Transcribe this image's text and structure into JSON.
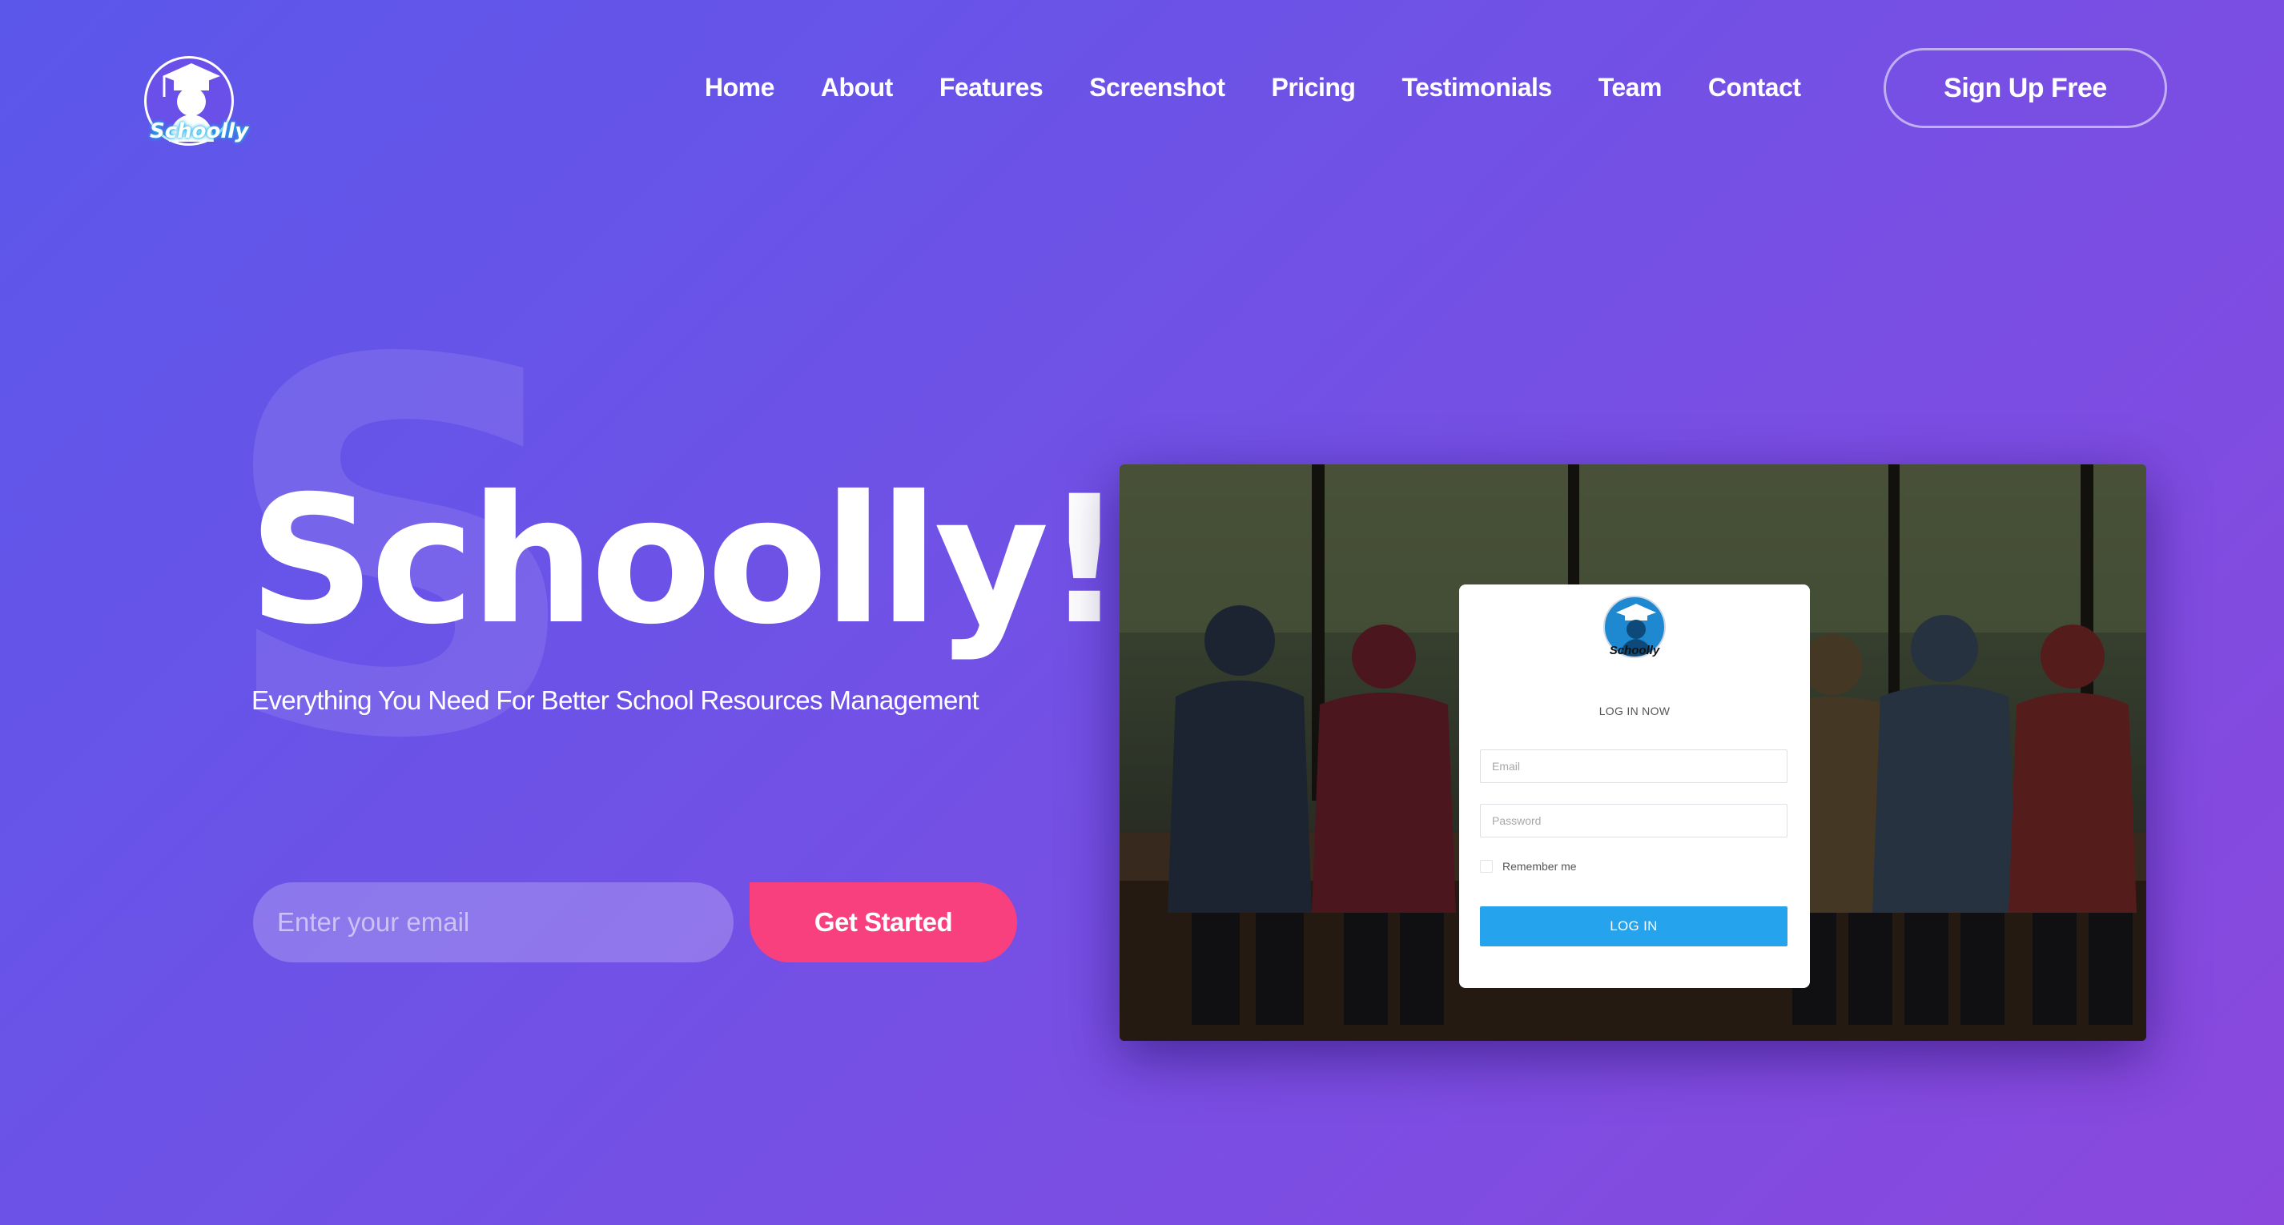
{
  "brand": {
    "logo_text": "Schoolly",
    "logo_icon": "graduate-cap-icon"
  },
  "nav": {
    "items": [
      {
        "label": "Home"
      },
      {
        "label": "About"
      },
      {
        "label": "Features"
      },
      {
        "label": "Screenshot"
      },
      {
        "label": "Pricing"
      },
      {
        "label": "Testimonials"
      },
      {
        "label": "Team"
      },
      {
        "label": "Contact"
      }
    ],
    "signup_label": "Sign Up Free"
  },
  "hero": {
    "bg_letter": "S",
    "title": "Schoolly!",
    "subtitle": "Everything You Need For Better School Resources Management",
    "email_placeholder": "Enter your email",
    "cta_label": "Get Started"
  },
  "mockup": {
    "logo_text": "Schoolly",
    "heading": "LOG IN NOW",
    "email_placeholder": "Email",
    "password_placeholder": "Password",
    "remember_label": "Remember me",
    "login_label": "LOG IN"
  },
  "colors": {
    "gradient_start": "#5b57ea",
    "gradient_end": "#8a48dd",
    "cta": "#f8407f",
    "login_button": "#25a3ec"
  }
}
